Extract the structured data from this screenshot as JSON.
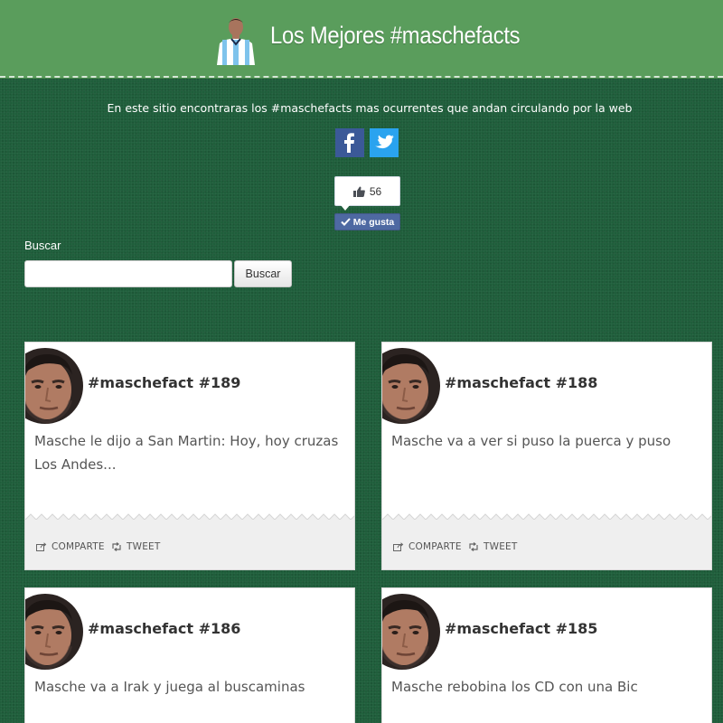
{
  "header": {
    "title": "Los Mejores #maschefacts"
  },
  "intro": {
    "text": "En este sitio encontraras los #maschefacts mas ocurrentes que andan circulando por la web"
  },
  "social": {
    "facebook_icon": "facebook-icon",
    "twitter_icon": "twitter-icon",
    "colors": {
      "facebook": "#3b5998",
      "twitter": "#2aa3ef"
    }
  },
  "like": {
    "count": "56",
    "button_label": "Me gusta"
  },
  "search": {
    "label": "Buscar",
    "input_value": "",
    "button_label": "Buscar"
  },
  "cards": [
    {
      "title": "#maschefact #189",
      "text": "Masche le dijo a San Martin: Hoy, hoy cruzas Los Andes...",
      "share_label": "COMPARTE",
      "tweet_label": "TWEET"
    },
    {
      "title": "#maschefact #188",
      "text": "Masche va a ver si puso la puerca y puso",
      "share_label": "COMPARTE",
      "tweet_label": "TWEET"
    },
    {
      "title": "#maschefact #186",
      "text": "Masche va a Irak y juega al buscaminas"
    },
    {
      "title": "#maschefact #185",
      "text": "Masche rebobina los CD con una Bic"
    }
  ],
  "colors": {
    "header_bg": "#5a9d5c",
    "page_bg": "#1f5e3b",
    "card_bg": "#ffffff",
    "card_footer_bg": "#efefef"
  }
}
